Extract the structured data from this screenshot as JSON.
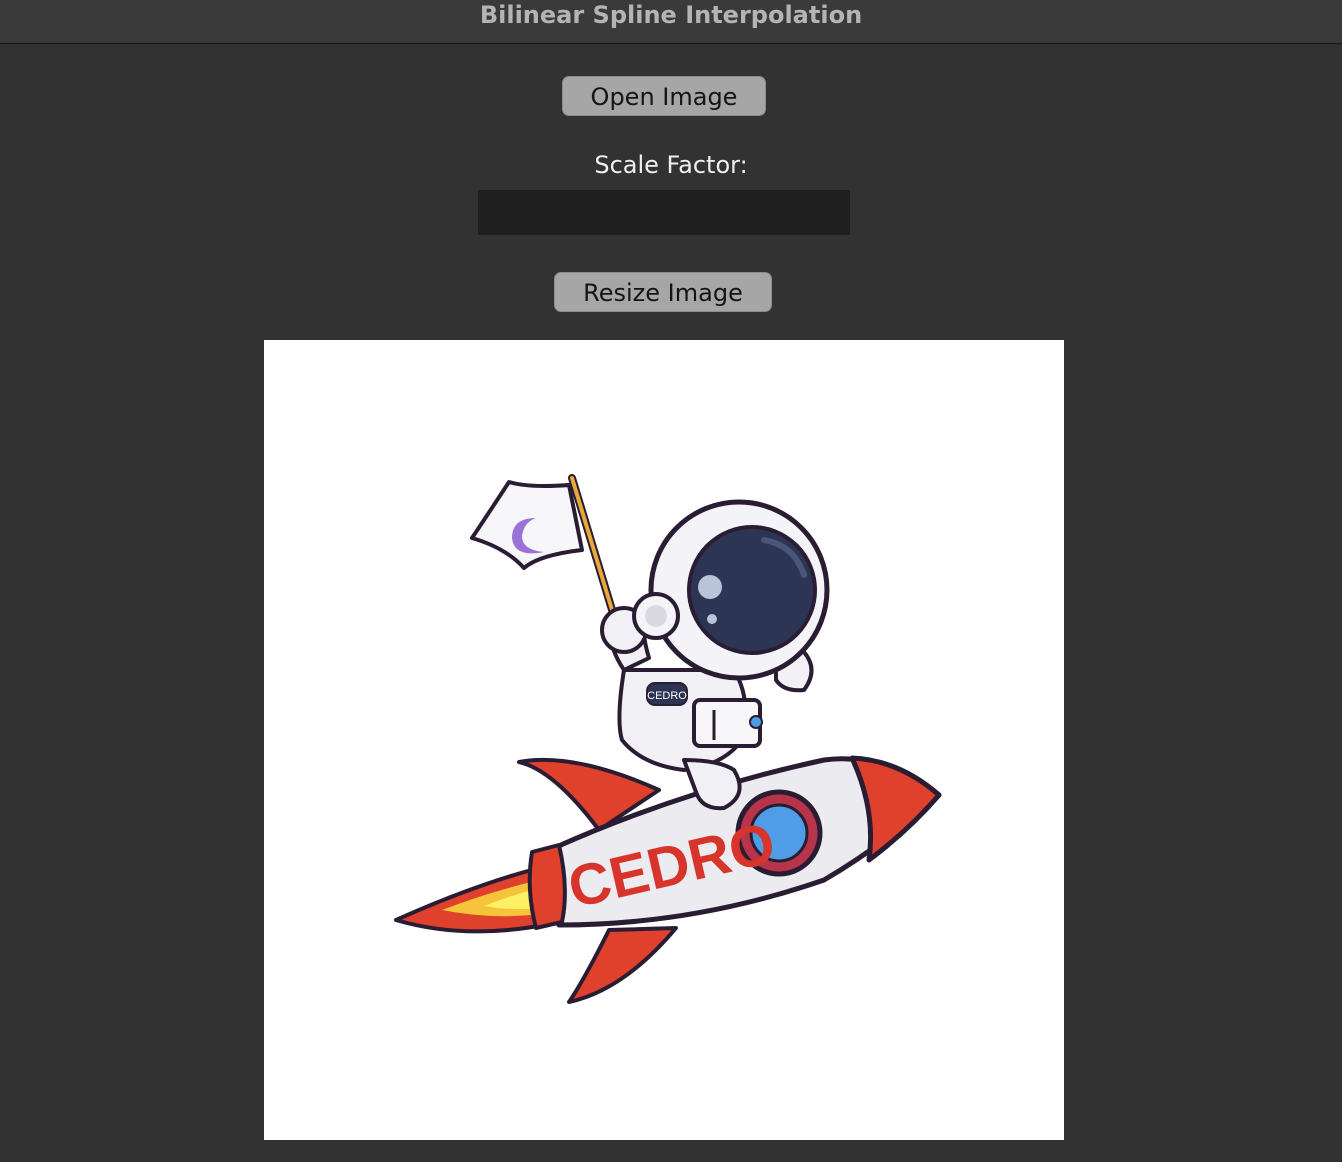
{
  "window": {
    "title": "Bilinear Spline Interpolation"
  },
  "controls": {
    "open_label": "Open Image",
    "scale_label": "Scale Factor:",
    "scale_value": "",
    "resize_label": "Resize Image"
  },
  "image": {
    "rocket_text": "CEDRO",
    "badge_text": "CEDRO"
  }
}
